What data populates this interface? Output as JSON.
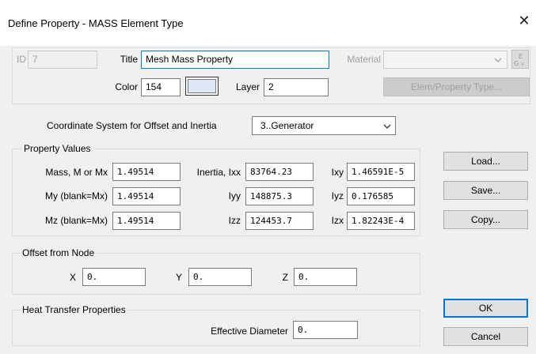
{
  "window": {
    "title": "Define Property - MASS Element Type"
  },
  "header": {
    "id_label": "ID",
    "id_value": "7",
    "title_label": "Title",
    "title_value": "Mesh Mass Property",
    "material_label": "Material",
    "material_value": "",
    "color_label": "Color",
    "color_value": "154",
    "color_swatch": "#dee7f5",
    "layer_label": "Layer",
    "layer_value": "2",
    "elem_property_type_label": "Elem/Property Type..."
  },
  "coord": {
    "label": "Coordinate System for Offset and Inertia",
    "value": "3..Generator"
  },
  "property_values": {
    "legend": "Property Values",
    "mass_label": "Mass, M or Mx",
    "mass_value": "1.49514",
    "my_label": "My (blank=Mx)",
    "my_value": "1.49514",
    "mz_label": "Mz (blank=Mx)",
    "mz_value": "1.49514",
    "ixx_label": "Inertia, Ixx",
    "ixx_value": "83764.23",
    "iyy_label": "Iyy",
    "iyy_value": "148875.3",
    "izz_label": "Izz",
    "izz_value": "124453.7",
    "ixy_label": "Ixy",
    "ixy_value": "1.46591E-5",
    "iyz_label": "Iyz",
    "iyz_value": "0.176585",
    "izx_label": "Izx",
    "izx_value": "1.82243E-4"
  },
  "side_buttons": {
    "load": "Load...",
    "save": "Save...",
    "copy": "Copy..."
  },
  "offset": {
    "legend": "Offset from Node",
    "x_label": "X",
    "x_value": "0.",
    "y_label": "Y",
    "y_value": "0.",
    "z_label": "Z",
    "z_value": "0."
  },
  "heat": {
    "legend": "Heat Transfer Properties",
    "diameter_label": "Effective Diameter",
    "diameter_value": "0."
  },
  "footer": {
    "ok": "OK",
    "cancel": "Cancel"
  }
}
